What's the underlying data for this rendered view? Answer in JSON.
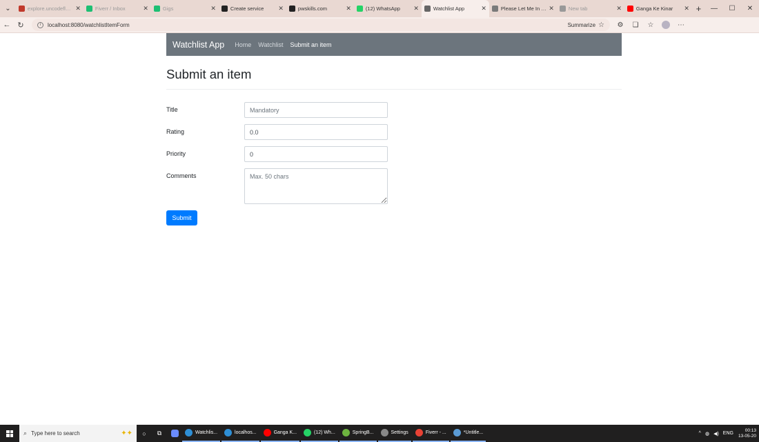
{
  "browser": {
    "tabs": [
      {
        "title": "explore.uncodeflo.com",
        "color": "#c0392b",
        "faded": true
      },
      {
        "title": "Fiverr / Inbox",
        "color": "#1dbf73",
        "faded": true
      },
      {
        "title": "Gigs",
        "color": "#1dbf73",
        "faded": true
      },
      {
        "title": "Create service",
        "color": "#222222",
        "faded": false
      },
      {
        "title": "pwskills.com",
        "color": "#222222",
        "faded": false
      },
      {
        "title": "(12) WhatsApp",
        "color": "#25d366",
        "faded": false
      },
      {
        "title": "Watchlist App",
        "color": "#666666",
        "faded": false,
        "active": true
      },
      {
        "title": "Please Let Me In Ho",
        "color": "#7a7a7a",
        "faded": false
      },
      {
        "title": "New tab",
        "color": "#999999",
        "faded": true
      },
      {
        "title": "Ganga Ke Kinar",
        "color": "#ff0000",
        "faded": false
      }
    ],
    "url": "localhost:8080/watchlistItemForm",
    "summarize_label": "Summarize"
  },
  "app": {
    "brand": "Watchlist App",
    "nav": {
      "home": "Home",
      "watchlist": "Watchlist",
      "submit": "Submit an item"
    },
    "heading": "Submit an item",
    "form": {
      "title_label": "Title",
      "title_value": "",
      "title_placeholder": "Mandatory",
      "rating_label": "Rating",
      "rating_value": "0.0",
      "priority_label": "Priority",
      "priority_value": "0",
      "comments_label": "Comments",
      "comments_value": "",
      "comments_placeholder": "Max. 50 chars",
      "submit_label": "Submit"
    }
  },
  "taskbar": {
    "search_placeholder": "Type here to search",
    "apps": [
      {
        "label": "Watchlis...",
        "color": "#2e8fd6"
      },
      {
        "label": "localhos...",
        "color": "#2e8fd6"
      },
      {
        "label": "Ganga K...",
        "color": "#ff0000"
      },
      {
        "label": "(12) Wh...",
        "color": "#25d366"
      },
      {
        "label": "SpringB...",
        "color": "#6db33f"
      },
      {
        "label": "Settings",
        "color": "#888888"
      },
      {
        "label": "Fiverr - ...",
        "color": "#e94235"
      },
      {
        "label": "*Untitle...",
        "color": "#5b9bd5"
      }
    ],
    "language": "ENG",
    "time": "00:13",
    "date": "13-05-20"
  },
  "colors": {
    "navbar": "#6c757d",
    "primary": "#007bff"
  }
}
